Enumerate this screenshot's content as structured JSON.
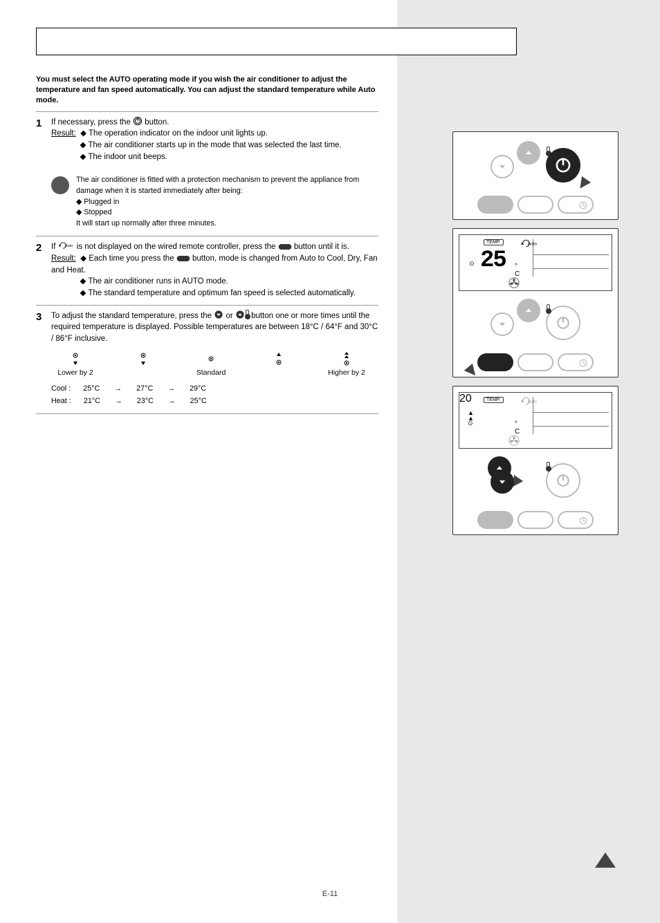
{
  "page_number": "E-11",
  "intro": "You must select the AUTO operating mode if you wish the air conditioner to adjust the temperature and fan speed automatically. You can adjust the standard temperature while Auto mode.",
  "steps": [
    {
      "num": "1",
      "lines": [
        "If necessary, press the <POWER> button.",
        "<u>Result:</u> ◆ The operation indicator on the indoor unit lights up.",
        "◆ The air conditioner starts up in the mode that was selected the last time.",
        "◆ The indoor unit beeps."
      ],
      "info": [
        "The air conditioner is fitted with a protection mechanism to prevent the appliance from damage when it is started immediately after being:",
        "◆ Plugged in",
        "◆ Stopped",
        "It will start up normally after three minutes."
      ]
    },
    {
      "num": "2",
      "lines": [
        "If <AUTOICON> is not displayed on the wired remote controller, press the <MODEBTN> button until it is.",
        "<u>Result:</u> ◆ Each time you press the <MODEBTN> button, mode is changed from Auto to Cool, Dry, Fan and Heat.",
        "◆ The air conditioner runs in AUTO mode.",
        "◆ The standard temperature and optimum fan speed is selected automatically."
      ]
    },
    {
      "num": "3",
      "lines": [
        "To adjust the standard temperature, press the <DOWN> or <UP_THERMO> button one or more times until the required temperature is displayed. Possible temperatures are between 18°C / 64°F and 30°C / 86°F inclusive."
      ]
    }
  ],
  "temp_table": {
    "heads": [
      "",
      "Lower by 2",
      "",
      "Standard",
      "",
      "Higher by 2"
    ],
    "rows": [
      [
        "Cool :",
        "25°C",
        "→",
        "27°C",
        "→",
        "29°C"
      ],
      [
        "Heat :",
        "21°C",
        "→",
        "23°C",
        "→",
        "25°C"
      ]
    ]
  },
  "icons": {
    "power": "power-icon",
    "auto": "Auto",
    "mode": "mode-button",
    "down": "down-triangle",
    "up": "up-triangle",
    "thermo": "thermometer"
  },
  "panels": {
    "p1": {
      "highlight": "power"
    },
    "p2": {
      "display_temp": "25",
      "display_label": "TEMP.",
      "highlight": "mode"
    },
    "p3": {
      "display_temp": "20",
      "display_label": "TEMP.",
      "highlight": "temp"
    }
  }
}
